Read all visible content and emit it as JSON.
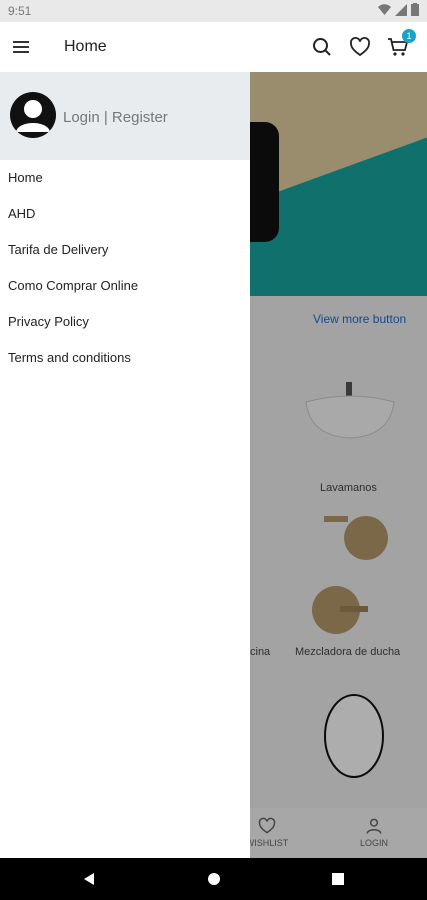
{
  "status": {
    "time": "9:51"
  },
  "appbar": {
    "title": "Home",
    "cart_count": "1"
  },
  "home": {
    "view_more": "View more button",
    "products": [
      {
        "label": "Lavamanos"
      },
      {
        "label": "cina"
      },
      {
        "label": "Mezcladora de ducha"
      }
    ],
    "bottom_nav": [
      {
        "label": "WISHLIST"
      },
      {
        "label": "LOGIN"
      }
    ]
  },
  "drawer": {
    "login_text": "Login | Register",
    "items": [
      {
        "label": "Home"
      },
      {
        "label": "AHD"
      },
      {
        "label": "Tarifa de Delivery"
      },
      {
        "label": "Como Comprar Online"
      },
      {
        "label": "Privacy Policy"
      },
      {
        "label": "Terms and conditions"
      }
    ]
  },
  "colors": {
    "accent": "#1f6bd3",
    "badge": "#1aa3c9",
    "drawer_header": "#e9ecef"
  }
}
